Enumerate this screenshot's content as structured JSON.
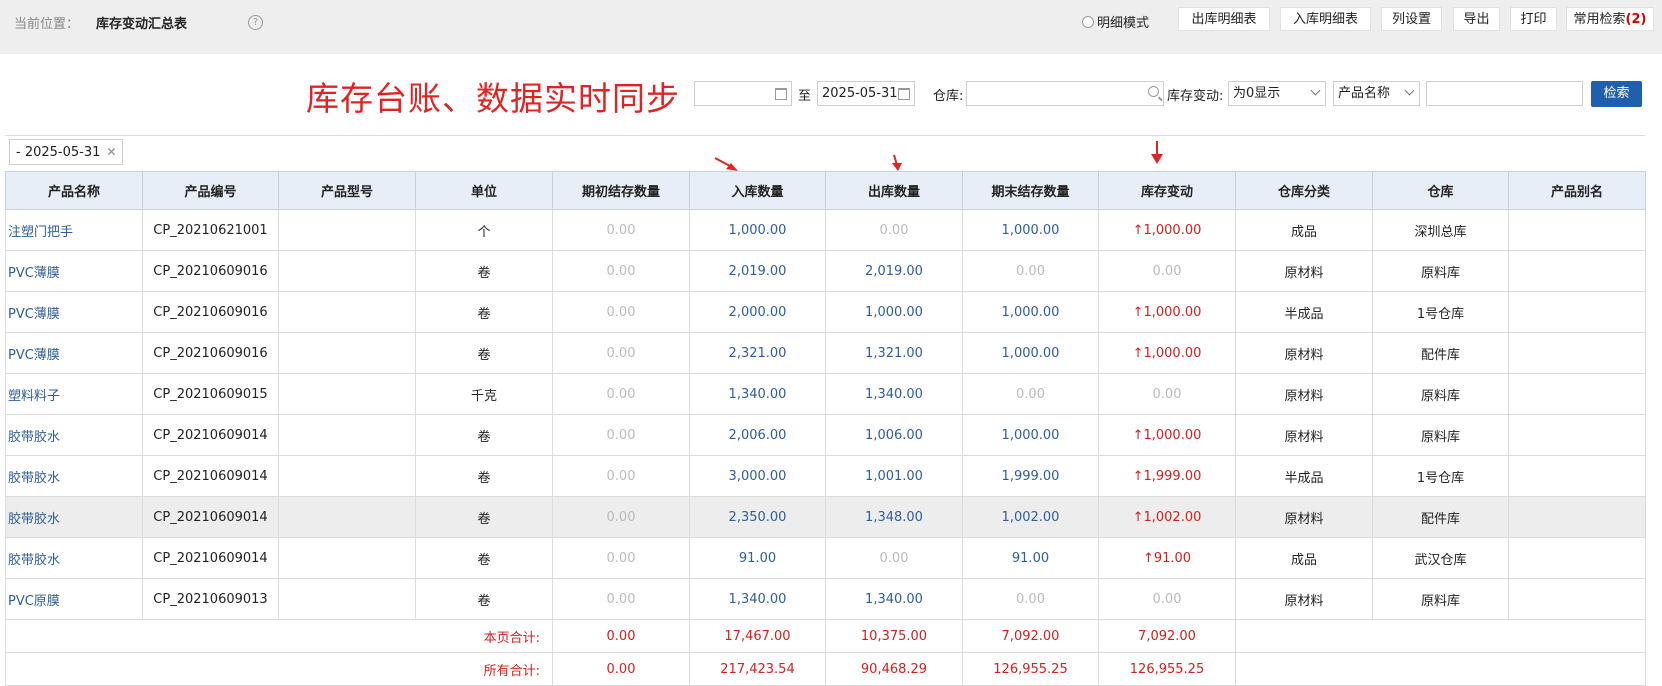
{
  "header": {
    "location_label": "当前位置：",
    "page_title": "库存变动汇总表",
    "help": "?",
    "detail_mode_label": "明细模式",
    "buttons": [
      "出库明细表",
      "入库明细表",
      "列设置",
      "导出",
      "打印"
    ],
    "common_search_label": "常用检索",
    "common_search_count": "(2)"
  },
  "promo_text": "库存台账、数据实时同步",
  "filters": {
    "date_from": "",
    "to_label": "至",
    "date_to": "2025-05-31",
    "warehouse_label": "仓库:",
    "warehouse_value": "",
    "change_label": "库存变动:",
    "change_value": "为0显示",
    "field_select": "产品名称",
    "keyword": "",
    "search_button": "检索"
  },
  "active_tag": "- 2025-05-31",
  "table": {
    "columns": [
      "产品名称",
      "产品编号",
      "产品型号",
      "单位",
      "期初结存数量",
      "入库数量",
      "出库数量",
      "期末结存数量",
      "库存变动",
      "仓库分类",
      "仓库",
      "产品别名"
    ],
    "rows": [
      {
        "name": "注塑门把手",
        "code": "CP_20210621001",
        "model": "",
        "unit": "个",
        "opening": "0.00",
        "in": "1,000.00",
        "out": "0.00",
        "closing": "1,000.00",
        "change": "↑1,000.00",
        "category": "成品",
        "warehouse": "深圳总库",
        "alias": ""
      },
      {
        "name": "PVC薄膜",
        "code": "CP_20210609016",
        "model": "",
        "unit": "卷",
        "opening": "0.00",
        "in": "2,019.00",
        "out": "2,019.00",
        "closing": "0.00",
        "change": "0.00",
        "category": "原材料",
        "warehouse": "原料库",
        "alias": ""
      },
      {
        "name": "PVC薄膜",
        "code": "CP_20210609016",
        "model": "",
        "unit": "卷",
        "opening": "0.00",
        "in": "2,000.00",
        "out": "1,000.00",
        "closing": "1,000.00",
        "change": "↑1,000.00",
        "category": "半成品",
        "warehouse": "1号仓库",
        "alias": ""
      },
      {
        "name": "PVC薄膜",
        "code": "CP_20210609016",
        "model": "",
        "unit": "卷",
        "opening": "0.00",
        "in": "2,321.00",
        "out": "1,321.00",
        "closing": "1,000.00",
        "change": "↑1,000.00",
        "category": "原材料",
        "warehouse": "配件库",
        "alias": ""
      },
      {
        "name": "塑料料子",
        "code": "CP_20210609015",
        "model": "",
        "unit": "千克",
        "opening": "0.00",
        "in": "1,340.00",
        "out": "1,340.00",
        "closing": "0.00",
        "change": "0.00",
        "category": "原材料",
        "warehouse": "原料库",
        "alias": ""
      },
      {
        "name": "胶带胶水",
        "code": "CP_20210609014",
        "model": "",
        "unit": "卷",
        "opening": "0.00",
        "in": "2,006.00",
        "out": "1,006.00",
        "closing": "1,000.00",
        "change": "↑1,000.00",
        "category": "原材料",
        "warehouse": "原料库",
        "alias": ""
      },
      {
        "name": "胶带胶水",
        "code": "CP_20210609014",
        "model": "",
        "unit": "卷",
        "opening": "0.00",
        "in": "3,000.00",
        "out": "1,001.00",
        "closing": "1,999.00",
        "change": "↑1,999.00",
        "category": "半成品",
        "warehouse": "1号仓库",
        "alias": ""
      },
      {
        "name": "胶带胶水",
        "code": "CP_20210609014",
        "model": "",
        "unit": "卷",
        "opening": "0.00",
        "in": "2,350.00",
        "out": "1,348.00",
        "closing": "1,002.00",
        "change": "↑1,002.00",
        "category": "原材料",
        "warehouse": "配件库",
        "alias": ""
      },
      {
        "name": "胶带胶水",
        "code": "CP_20210609014",
        "model": "",
        "unit": "卷",
        "opening": "0.00",
        "in": "91.00",
        "out": "0.00",
        "closing": "91.00",
        "change": "↑91.00",
        "category": "成品",
        "warehouse": "武汉仓库",
        "alias": ""
      },
      {
        "name": "PVC原膜",
        "code": "CP_20210609013",
        "model": "",
        "unit": "卷",
        "opening": "0.00",
        "in": "1,340.00",
        "out": "1,340.00",
        "closing": "0.00",
        "change": "0.00",
        "category": "原材料",
        "warehouse": "原料库",
        "alias": ""
      }
    ],
    "page_total": {
      "label": "本页合计:",
      "opening": "0.00",
      "in": "17,467.00",
      "out": "10,375.00",
      "closing": "7,092.00",
      "change": "7,092.00"
    },
    "grand_total": {
      "label": "所有合计:",
      "opening": "0.00",
      "in": "217,423.54",
      "out": "90,468.29",
      "closing": "126,955.25",
      "change": "126,955.25"
    }
  },
  "colors": {
    "link": "#2f5d99",
    "up": "#d12020",
    "primary": "#1f5fad",
    "header_bg": "#e8eef8",
    "promo": "#e02424"
  }
}
